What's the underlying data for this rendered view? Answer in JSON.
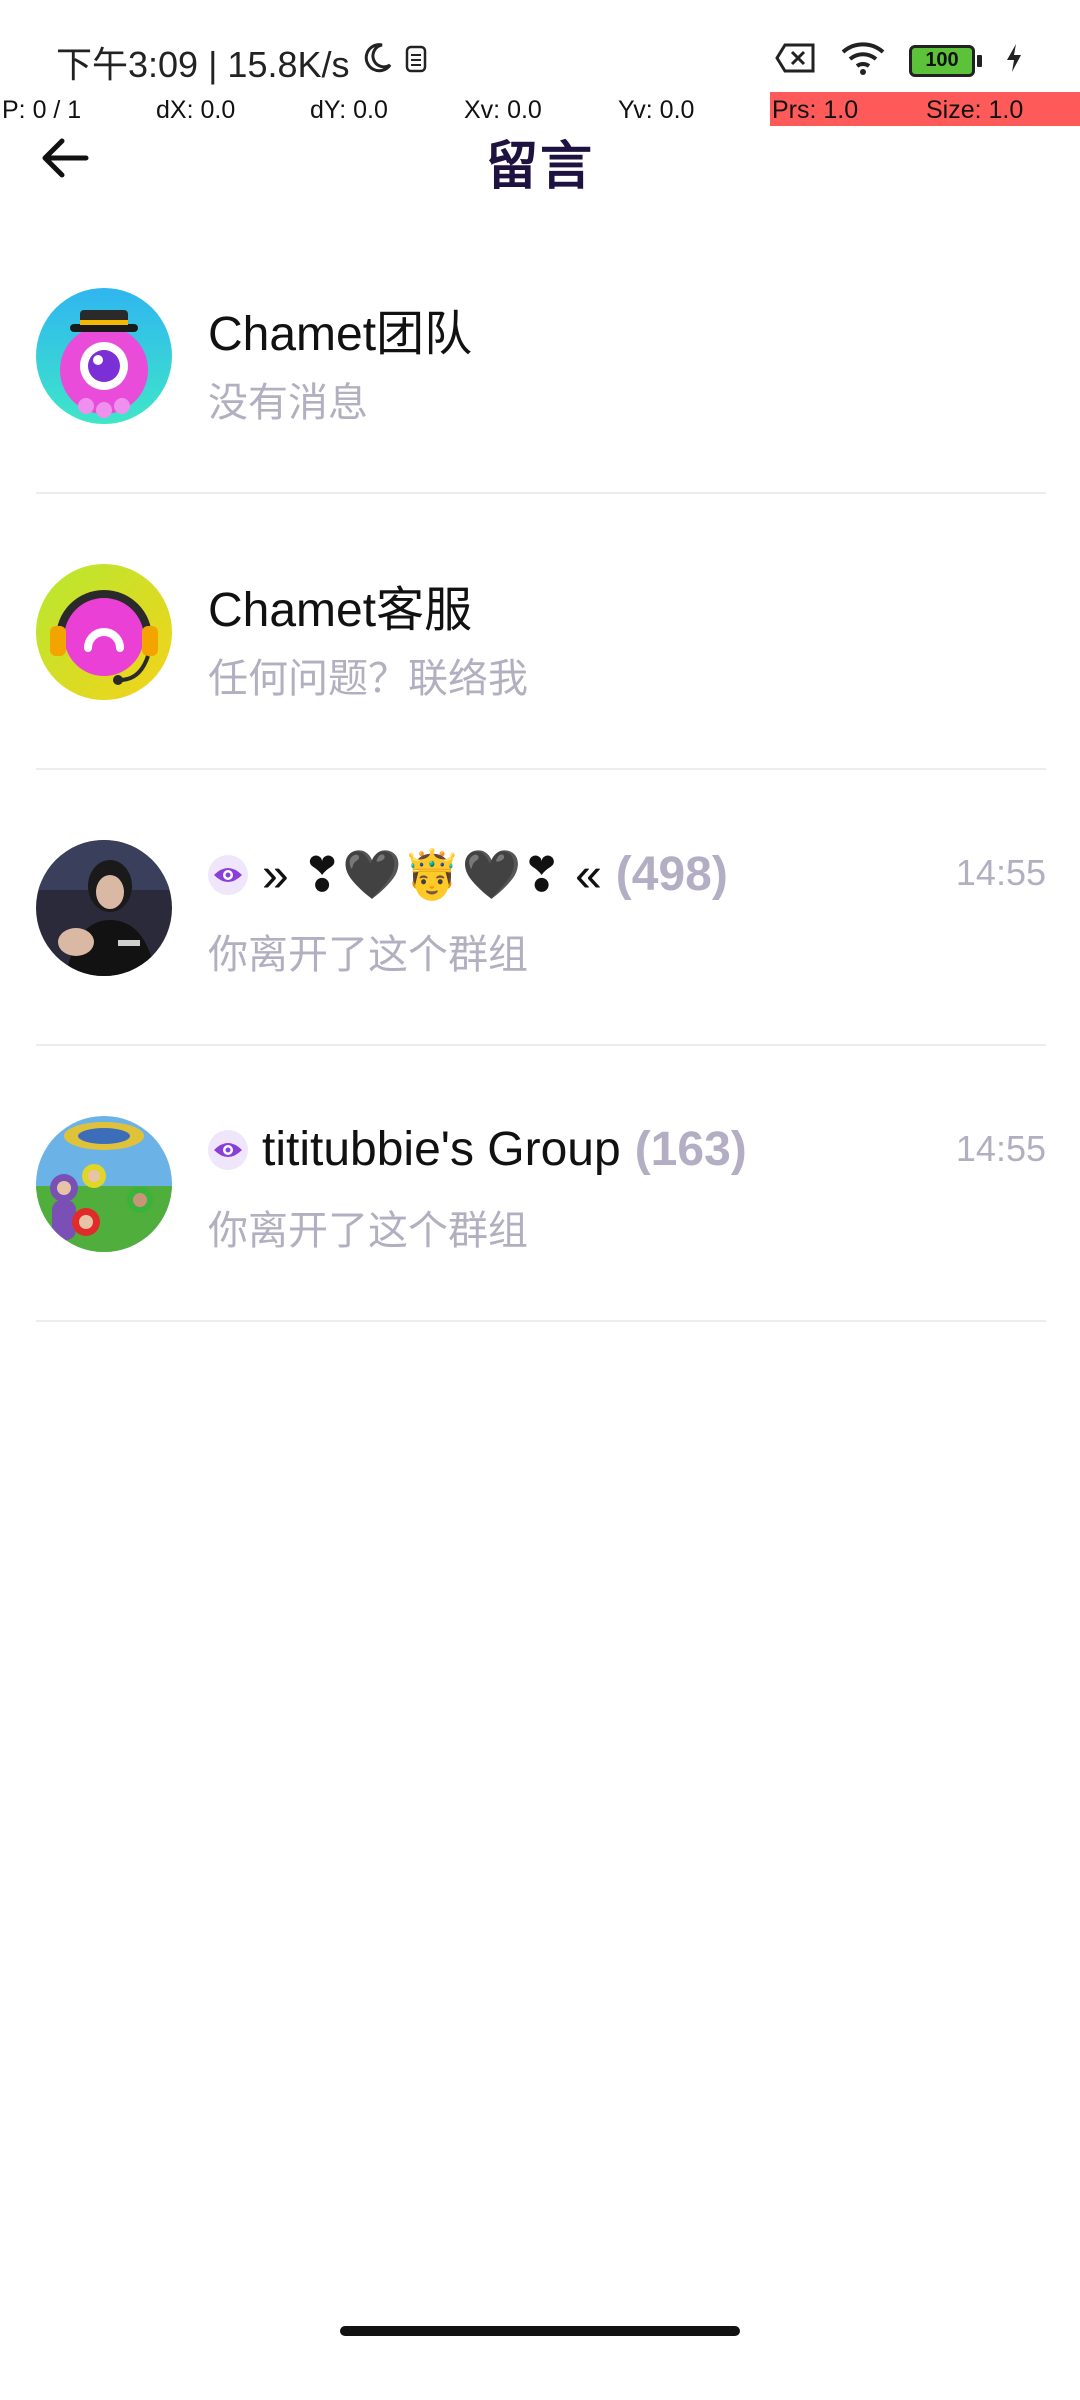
{
  "status_bar": {
    "time_and_speed": "下午3:09 | 15.8K/s",
    "battery_level": "100",
    "icons": [
      "moon-icon",
      "sim-icon",
      "no-sim-icon",
      "wifi-icon",
      "battery-icon",
      "charging-icon"
    ]
  },
  "debug_overlay": {
    "p": "P: 0 / 1",
    "dx": "dX: 0.0",
    "dy": "dY: 0.0",
    "xv": "Xv: 0.0",
    "yv": "Yv: 0.0",
    "prs": "Prs: 1.0",
    "size": "Size: 1.0",
    "highlight_color": "#ff5a5a"
  },
  "header": {
    "title": "留言",
    "title_color": "#1e1240",
    "back_icon": "arrow-left-icon"
  },
  "conversations": [
    {
      "name": "Chamet团队",
      "count": "",
      "subtitle": "没有消息",
      "time": "",
      "avatar": "chamet-team-avatar"
    },
    {
      "name": "Chamet客服",
      "count": "",
      "subtitle": "任何问题？联络我",
      "time": "",
      "avatar": "chamet-support-avatar"
    },
    {
      "name": "» ❣🖤🤴🖤❣ «",
      "count": "(498)",
      "subtitle": "你离开了这个群组",
      "time": "14:55",
      "avatar": "group-avatar-photo",
      "badge_icon": "eye-icon"
    },
    {
      "name": "tititubbie's Group",
      "count": "(163)",
      "subtitle": "你离开了这个群组",
      "time": "14:55",
      "avatar": "teletubbies-avatar",
      "badge_icon": "eye-icon"
    }
  ],
  "colors": {
    "muted_text": "#b2b0c0",
    "divider": "#ececf1",
    "eye_badge": "#8b3fd9"
  }
}
